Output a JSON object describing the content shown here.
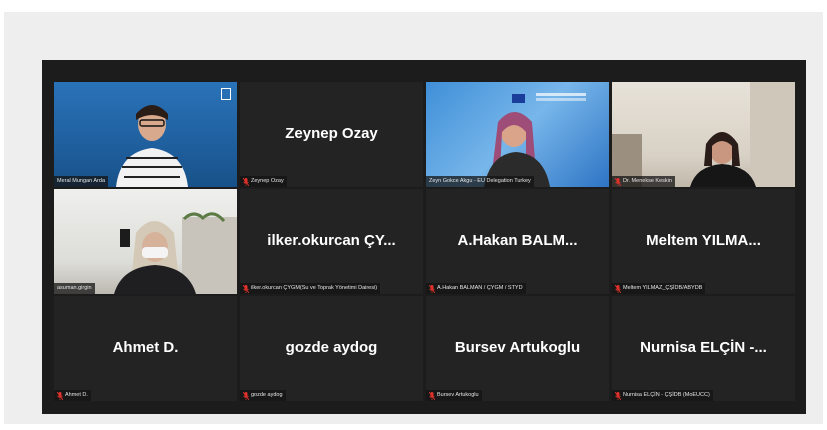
{
  "participants": [
    {
      "big_name": "",
      "label": "Meral Mungan Arda",
      "video": true,
      "muted": false,
      "active": false
    },
    {
      "big_name": "Zeynep Ozay",
      "label": "Zeynep Ozay",
      "video": false,
      "muted": true,
      "active": false
    },
    {
      "big_name": "",
      "label": "Zeyn Gokce Akgu - EU Delegation Turkey",
      "video": true,
      "muted": false,
      "active": false
    },
    {
      "big_name": "",
      "label": "Dr. Menekse Keskin",
      "video": true,
      "muted": true,
      "active": true
    },
    {
      "big_name": "",
      "label": "asuman.girgin",
      "video": true,
      "muted": false,
      "active": false
    },
    {
      "big_name": "ilker.okurcan ÇY...",
      "label": "ilker.okurcan ÇYGM(Su ve Toprak Yönetimi Dairesi)",
      "video": false,
      "muted": true,
      "active": false
    },
    {
      "big_name": "A.Hakan BALM...",
      "label": "A.Hakan BALMAN / ÇYGM / STYD",
      "video": false,
      "muted": true,
      "active": false
    },
    {
      "big_name": "Meltem YILMA...",
      "label": "Meltem YILMAZ_ÇŞİDB/ABYDB",
      "video": false,
      "muted": true,
      "active": false
    },
    {
      "big_name": "Ahmet D.",
      "label": "Ahmet D.",
      "video": false,
      "muted": true,
      "active": false
    },
    {
      "big_name": "gozde aydog",
      "label": "gozde aydog",
      "video": false,
      "muted": true,
      "active": false
    },
    {
      "big_name": "Bursev Artukoglu",
      "label": "Bursev Artukoglu",
      "video": false,
      "muted": true,
      "active": false
    },
    {
      "big_name": "Nurnisa ELÇİN -...",
      "label": "Nurnisa ELÇİN - ÇŞİDB (MoEUCC)",
      "video": false,
      "muted": true,
      "active": false
    }
  ],
  "colors": {
    "active_speaker": "#c9f04a",
    "muted_icon": "#e0322b",
    "tile_bg": "#232323",
    "meeting_bg": "#1c1c1c"
  },
  "icons": {
    "muted": "mic-muted-icon"
  }
}
